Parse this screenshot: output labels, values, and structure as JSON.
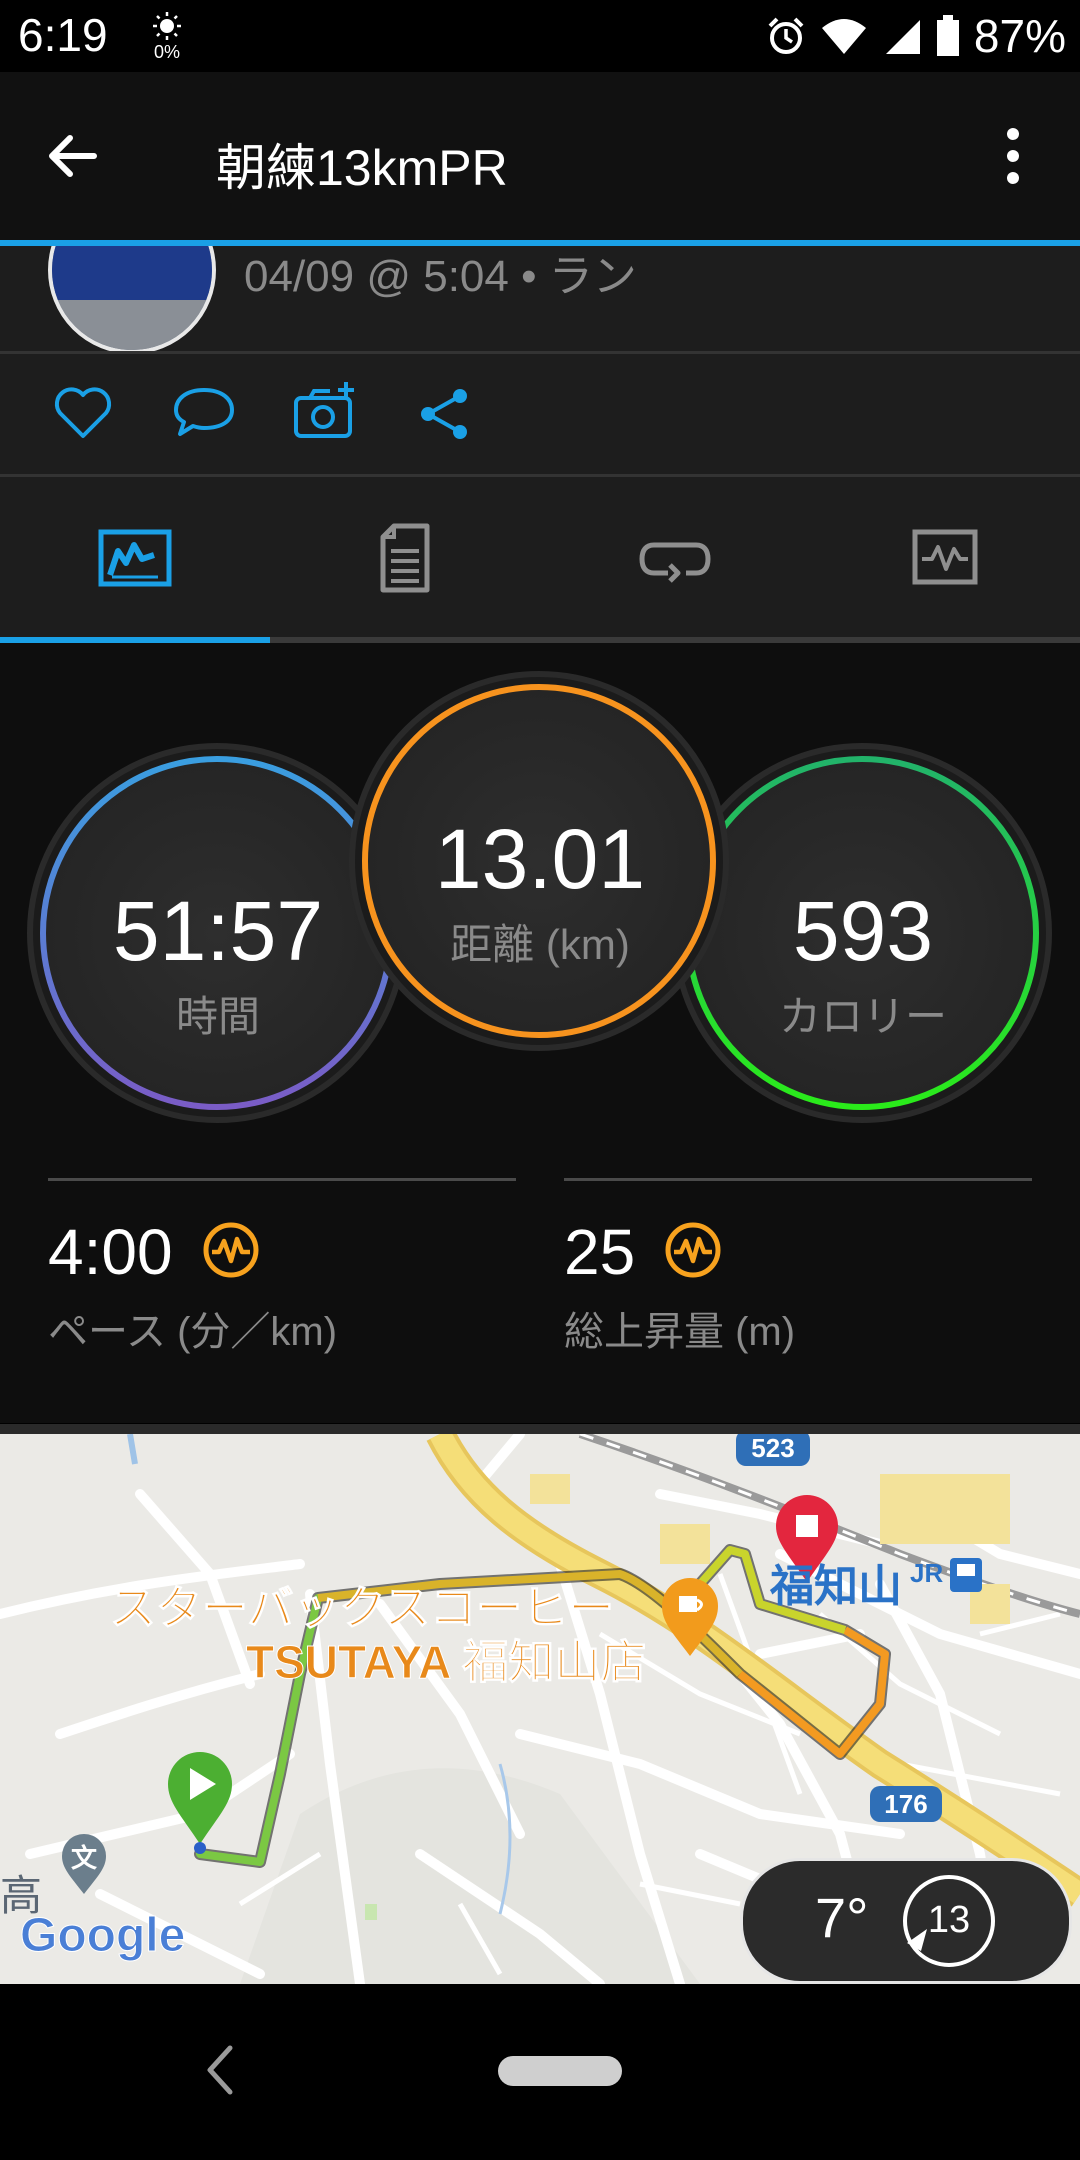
{
  "status_bar": {
    "time": "6:19",
    "brightness": "0%",
    "battery": "87%",
    "icons": [
      "alarm-icon",
      "wifi-icon",
      "signal-icon",
      "battery-icon"
    ]
  },
  "app_bar": {
    "title": "朝練13kmPR",
    "icons": [
      "back-arrow-icon",
      "more-vert-icon"
    ]
  },
  "activity": {
    "meta": "04/09 @ 5:04 • ラン"
  },
  "actions": [
    "heart-icon",
    "comment-icon",
    "add-photo-icon",
    "share-icon"
  ],
  "tabs": [
    "overview-tab-icon",
    "details-tab-icon",
    "laps-tab-icon",
    "charts-tab-icon"
  ],
  "stats": {
    "time_value": "51:57",
    "time_label": "時間",
    "distance_value": "13.01",
    "distance_label": "距離 (km)",
    "calories_value": "593",
    "calories_label": "カロリー",
    "pace_value": "4:00",
    "pace_label": "ペース (分／km)",
    "ascent_value": "25",
    "ascent_label": "総上昇量 (m)"
  },
  "map": {
    "poi_line1": "スターバックスコーヒー",
    "poi_line2": "TSUTAYA 福知山店",
    "station": "福知山",
    "jr": "JR",
    "route_523": "523",
    "route_176": "176",
    "school": "文",
    "kou": "高",
    "google": "Google",
    "weather_temp": "7°",
    "wind_speed": "13"
  },
  "colors": {
    "accent": "#1aa0e6",
    "distance_ring": "#f7931e",
    "calories_ring": "#22d04a",
    "time_ring_top": "#3a9ee0",
    "time_ring_bottom": "#7a5cc6"
  }
}
